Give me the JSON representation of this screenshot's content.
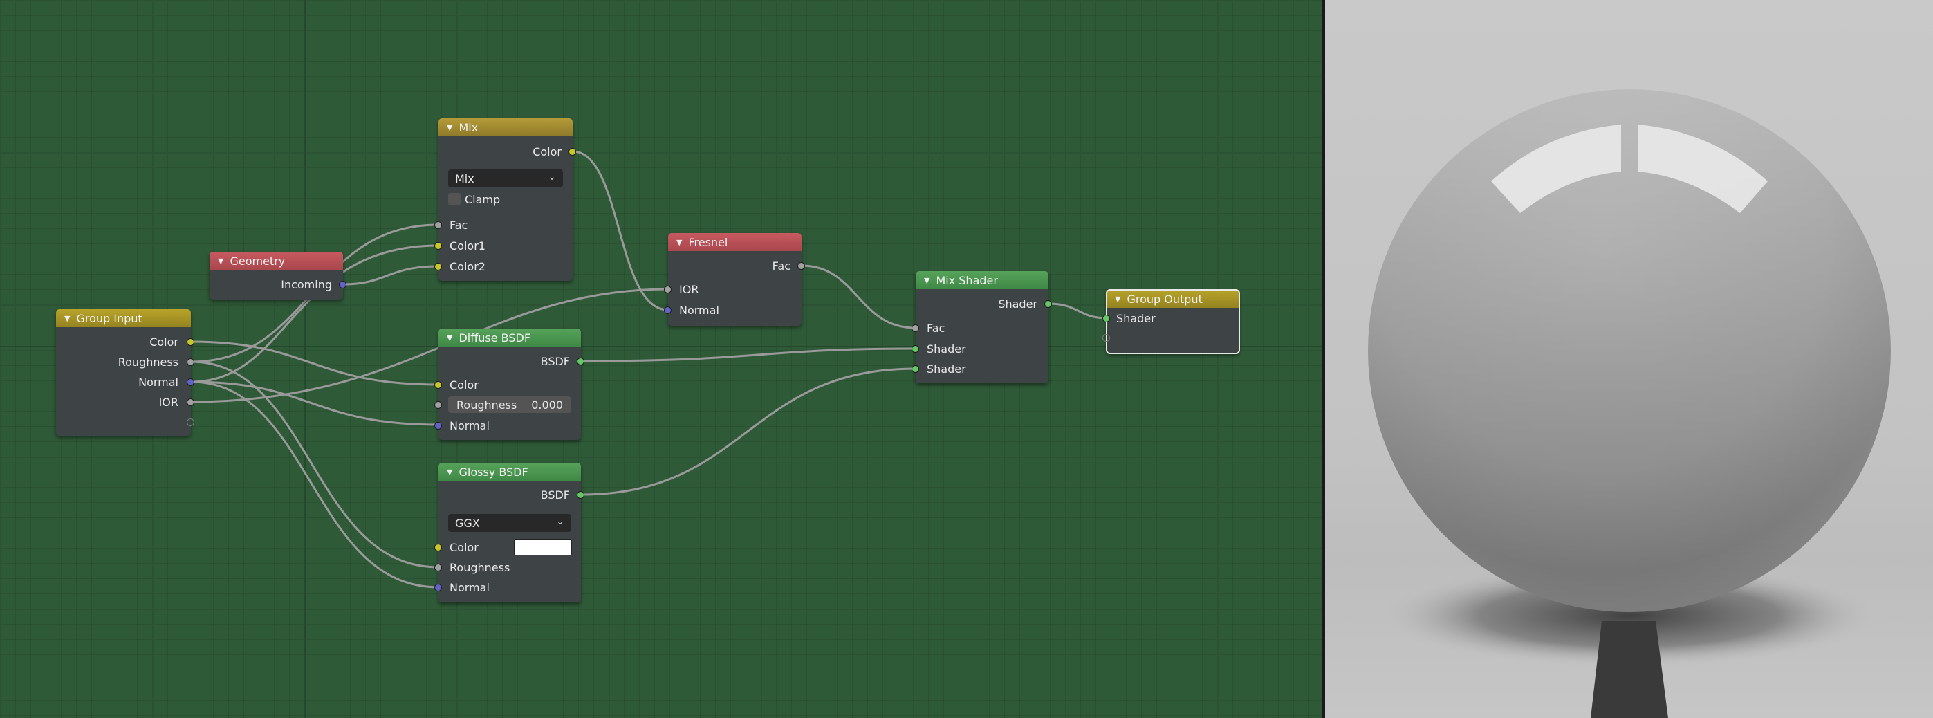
{
  "nodes": {
    "group_input": {
      "title": "Group Input",
      "outputs": [
        "Color",
        "Roughness",
        "Normal",
        "IOR"
      ]
    },
    "geometry": {
      "title": "Geometry",
      "outputs": [
        "Incoming"
      ]
    },
    "mix": {
      "title": "Mix",
      "output": "Color",
      "blend_mode": "Mix",
      "clamp_label": "Clamp",
      "inputs": [
        "Fac",
        "Color1",
        "Color2"
      ]
    },
    "fresnel": {
      "title": "Fresnel",
      "output": "Fac",
      "inputs": [
        "IOR",
        "Normal"
      ]
    },
    "diffuse": {
      "title": "Diffuse BSDF",
      "output": "BSDF",
      "inputs": [
        "Color",
        "Normal"
      ],
      "roughness_label": "Roughness",
      "roughness_value": "0.000"
    },
    "glossy": {
      "title": "Glossy BSDF",
      "output": "BSDF",
      "distribution": "GGX",
      "inputs": [
        "Color",
        "Roughness",
        "Normal"
      ],
      "color_value": "#ffffff"
    },
    "mix_shader": {
      "title": "Mix Shader",
      "output": "Shader",
      "inputs": [
        "Fac",
        "Shader",
        "Shader"
      ]
    },
    "group_output": {
      "title": "Group Output",
      "inputs": [
        "Shader"
      ]
    }
  },
  "colors": {
    "editor_background": "#2f5a38",
    "socket_color": "#c7c729",
    "socket_float": "#a1a1a1",
    "socket_vector": "#6363c7",
    "socket_shader": "#63c763",
    "wire": "#9a9a9a"
  }
}
